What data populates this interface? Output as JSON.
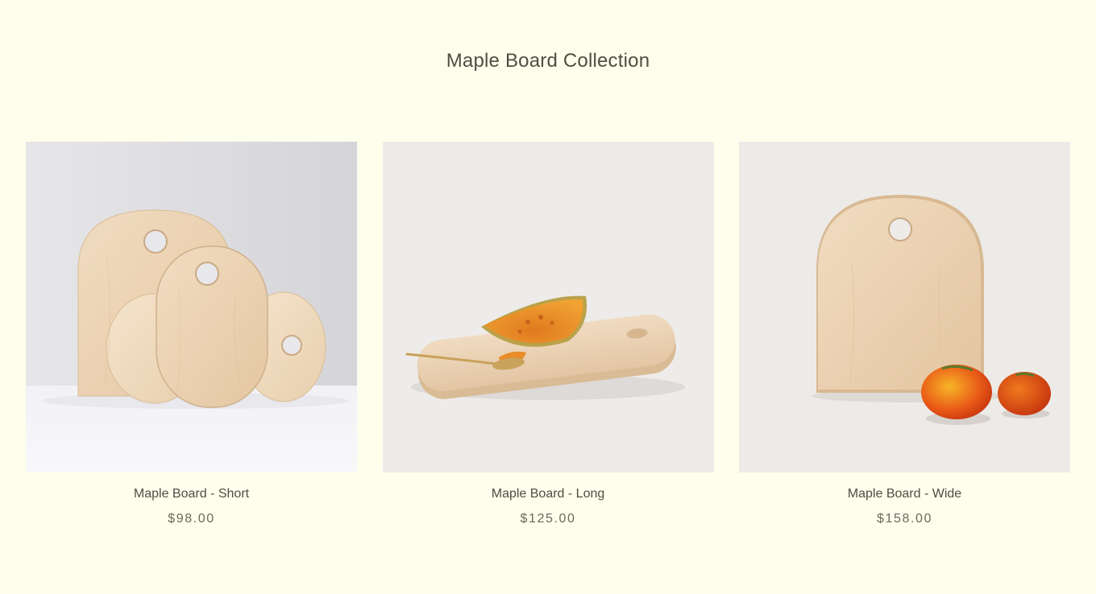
{
  "collection": {
    "title": "Maple Board Collection"
  },
  "products": [
    {
      "name": "Maple Board - Short",
      "price": "$98.00"
    },
    {
      "name": "Maple Board - Long",
      "price": "$125.00"
    },
    {
      "name": "Maple Board - Wide",
      "price": "$158.00"
    }
  ],
  "colors": {
    "page_background": "#fefeec",
    "text": "#4e4e44",
    "maple_wood": "#efd9bd"
  }
}
